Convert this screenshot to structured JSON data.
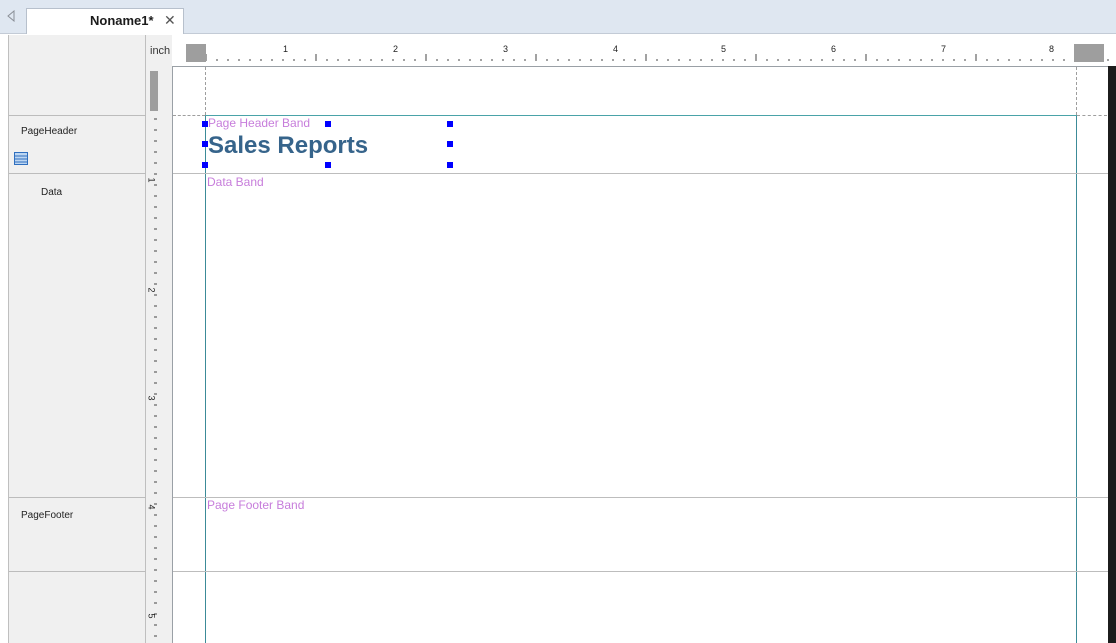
{
  "tabs": {
    "scroll_left_icon": "triangle-left-icon",
    "document": {
      "title": "Noname1*",
      "close_icon": "close-icon"
    }
  },
  "ruler": {
    "unit": "inch",
    "horizontal_marks": [
      "1",
      "2",
      "3",
      "4",
      "5",
      "6",
      "7",
      "8"
    ],
    "vertical_marks": [
      "1",
      "2",
      "3",
      "4",
      "5"
    ]
  },
  "bands": [
    {
      "name": "PageHeader",
      "caption": "Page Header Band"
    },
    {
      "name": "Data",
      "caption": "Data Band",
      "icon": "data-band-icon"
    },
    {
      "name": "PageFooter",
      "caption": "Page Footer Band"
    }
  ],
  "report": {
    "title_text": "Sales Reports",
    "title_color": "#36648b"
  },
  "colors": {
    "band_caption": "#c77ddb",
    "selection_handle": "#0000ff",
    "margin_line": "#4aa3a8"
  }
}
